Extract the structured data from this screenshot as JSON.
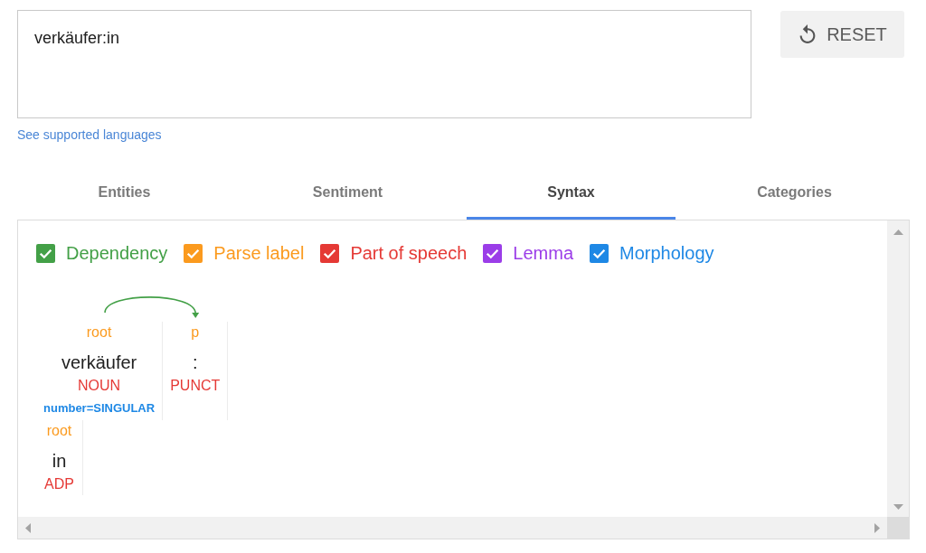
{
  "input": {
    "value": "verkäufer:in"
  },
  "reset_button": {
    "label": "RESET"
  },
  "languages_link": {
    "label": "See supported languages"
  },
  "tabs": [
    {
      "label": "Entities",
      "selected": false
    },
    {
      "label": "Sentiment",
      "selected": false
    },
    {
      "label": "Syntax",
      "selected": true
    },
    {
      "label": "Categories",
      "selected": false
    }
  ],
  "layers": [
    {
      "kind": "dependency",
      "label": "Dependency",
      "checked": true,
      "color": "#43a047"
    },
    {
      "kind": "parse_label",
      "label": "Parse label",
      "checked": true,
      "color": "#fb9a1e"
    },
    {
      "kind": "part_of_speech",
      "label": "Part of speech",
      "checked": true,
      "color": "#e53935"
    },
    {
      "kind": "lemma",
      "label": "Lemma",
      "checked": true,
      "color": "#9b3de8"
    },
    {
      "kind": "morphology",
      "label": "Morphology",
      "checked": true,
      "color": "#1e88e5"
    }
  ],
  "sentences": [
    {
      "tokens": [
        {
          "parse_label": "root",
          "text": "verkäufer",
          "part_of_speech": "NOUN",
          "morphology": "number=SINGULAR",
          "arc_from_previous": false
        },
        {
          "parse_label": "p",
          "text": ":",
          "part_of_speech": "PUNCT",
          "arc_from_previous": true
        }
      ]
    },
    {
      "tokens": [
        {
          "parse_label": "root",
          "text": "in",
          "part_of_speech": "ADP",
          "arc_from_previous": false
        }
      ]
    }
  ]
}
